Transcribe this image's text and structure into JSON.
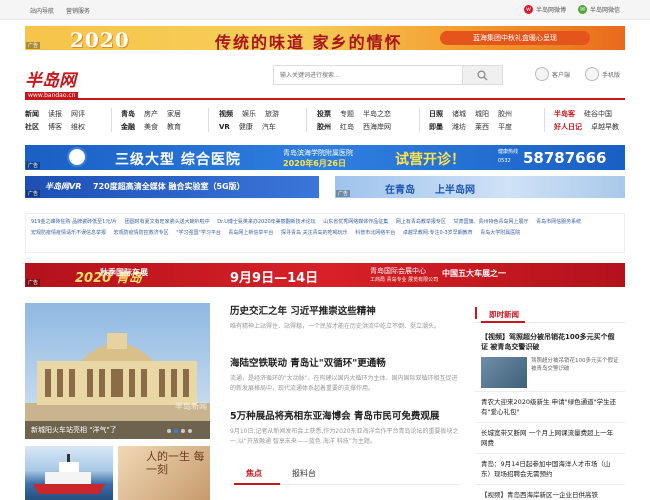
{
  "topbar": {
    "left": [
      "站内导航",
      "营销服务"
    ],
    "right": [
      {
        "icon": "weibo-icon",
        "label": "半岛网微博"
      },
      {
        "icon": "wechat-icon",
        "label": "半岛网微信"
      }
    ]
  },
  "banner_top": {
    "year": "2020",
    "title": "传统的味道 家乡的情怀",
    "slogan": "蓝海集团中秋礼盒暖心呈现",
    "ad": "广告"
  },
  "header": {
    "logo_text": "半岛网",
    "logo_url": "www.bandao.cn",
    "search_placeholder": "输入关键词进行搜索...",
    "client_label": "客户端",
    "mobile_label": "手机版"
  },
  "nav": {
    "groups": [
      {
        "row1": [
          "新闻",
          "读报",
          "网评"
        ],
        "row2": [
          "社区",
          "博客",
          "维权"
        ]
      },
      {
        "row1": [
          "青岛",
          "房产",
          "家居"
        ],
        "row2": [
          "金融",
          "美食",
          "教育"
        ]
      },
      {
        "row1": [
          "视频",
          "娱乐",
          "旅游"
        ],
        "row2": [
          "VR",
          "健康",
          "汽车"
        ]
      },
      {
        "row1": [
          "投票",
          "专题",
          "半岛之恋"
        ],
        "row2": [
          "胶州",
          "红岛",
          "西海岸网"
        ]
      },
      {
        "row1": [
          "日照",
          "诸城",
          "城阳",
          "胶州"
        ],
        "row2": [
          "即墨",
          "潍坊",
          "莱西",
          "平度"
        ]
      },
      {
        "row1": [
          "半岛客",
          "硅谷中国"
        ],
        "row2": [
          "好人日记",
          "卓越早教"
        ]
      }
    ]
  },
  "banner_hospital": {
    "title": "三级大型 综合医院",
    "subtitle": "青岛滨海学院附属医院",
    "date": "2020年6月26日",
    "opening": "试营开诊！",
    "hotline_label": "健康热线",
    "area_code": "0532",
    "phone": "58787666",
    "ad": "广告"
  },
  "banner_vr": {
    "logo": "半岛网VR",
    "text": "720度超高清全媒体 融合实验室（5G版）",
    "ad": "广告"
  },
  "banner_qd": {
    "text1": "在青岛",
    "text2": "上半岛网",
    "ad": "广告"
  },
  "links": [
    "919金之峰砖狂购 品牌瓷砖低至1元/片",
    "团圆时有夏文有旺家瓷头送大喇叭啦中",
    "Dr.U博士氨英来办2020年美丽翻新技术论坛",
    "山东省优秀网络媒体作品征集",
    "网上有青岛教举报专区",
    "甘肃国旗、贵州特色青岛网上展厅",
    "青岛市网信服务系统",
    "宏观防疫情疫情请乐不误信息举报",
    "宏观防疫情防控救济专区",
    "\"学习强国\"学习平台",
    "青岛网上新信举平台",
    "探寻青岛 关注青岛的吃喝玩乐",
    "科普市北网络平台",
    "卓越早教网:专注0-3岁早期教育",
    "青岛大学附属医院"
  ],
  "banner_expo": {
    "brand": "2020 青岛",
    "title": "秋季国际车展",
    "date": "9月9日—14日",
    "venue": "青岛国际会展中心",
    "venue_sub": "工商局 青岛专业 展览有限公司",
    "tagline": "中国五大车展之一",
    "ad": "广告"
  },
  "photo": {
    "caption": "新城阳火车站亮相 \"洋气\"了",
    "watermark": "半岛新闻"
  },
  "thumb2_text": "人的一生 每一刻",
  "news": [
    {
      "title": "历史交汇之年 习近平推崇这些精神",
      "desc": "唯有精神上站得住、站得稳，一个民族才能在历史洪流中屹立不倒、挺立潮头。"
    },
    {
      "title": "海陆空铁联动 青岛让\"双循环\"更通畅",
      "desc": "流通，是经济循环的\"大动脉\"。在构建以国内大循环为主体、国内国际双循环相互促进的新发展格局中，现代流通体系起着重要的支撑作用。"
    },
    {
      "title": "5万种展品将亮相东亚海博会 青岛市民可免费观展",
      "desc": "9月10日,记者从新闻发布会上获悉,作为2020东亚海洋合作平台青岛论坛的重要板块之一,以“开放融通 智享未来——蓝色 海洋 科技”为主题。"
    }
  ],
  "tabs": [
    "焦点",
    "报料台"
  ],
  "sidebar": {
    "title": "即时新闻",
    "top_item": "【视频】驾照超分被吊销花100多元买个假证 被青岛交警识破",
    "top_desc": "驾照超分被吊销花100多元买个假证 被青岛交警识破",
    "items": [
      "青农大迎来2020级新生 申请\"绿色通道\"学生还有\"爱心礼包\"",
      "长城宽带又断网 一个月上网课流量费超上一年网费",
      "青岛：9月14日起参加中国海洋人才市场（山东）现场招聘会无需预约",
      "【视频】青岛西海岸新区一企业日供高铁"
    ]
  }
}
